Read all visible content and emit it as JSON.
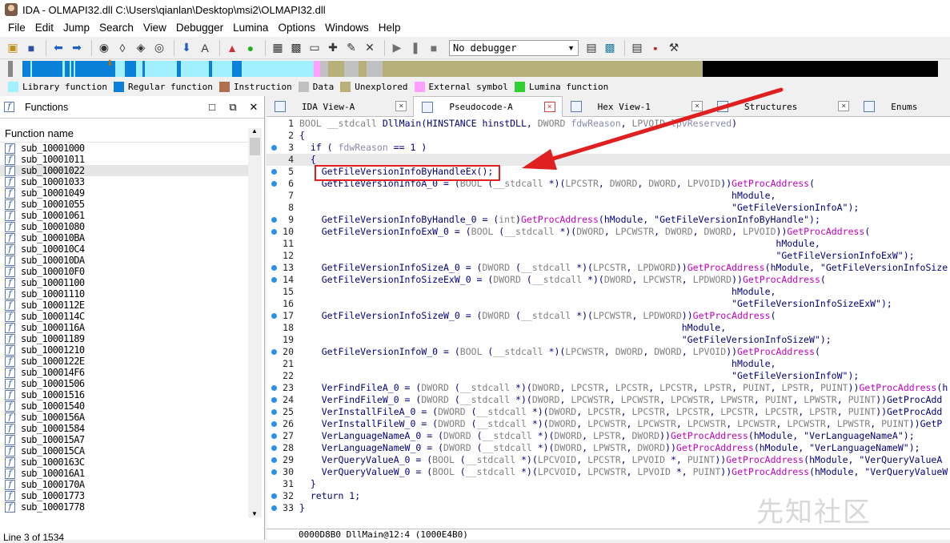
{
  "window": {
    "title": "IDA - OLMAPI32.dll C:\\Users\\qianlan\\Desktop\\msi2\\OLMAPI32.dll"
  },
  "menu": [
    "File",
    "Edit",
    "Jump",
    "Search",
    "View",
    "Debugger",
    "Lumina",
    "Options",
    "Windows",
    "Help"
  ],
  "toolbar": {
    "debugger_value": "No debugger"
  },
  "legend": [
    {
      "label": "Library function",
      "color": "#a0f0ff"
    },
    {
      "label": "Regular function",
      "color": "#0a80d8"
    },
    {
      "label": "Instruction",
      "color": "#b07050"
    },
    {
      "label": "Data",
      "color": "#c0c0c0"
    },
    {
      "label": "Unexplored",
      "color": "#b8b07a"
    },
    {
      "label": "External symbol",
      "color": "#ffa0ff"
    },
    {
      "label": "Lumina function",
      "color": "#30d030"
    }
  ],
  "functions_panel": {
    "title": "Functions",
    "column_header": "Function name",
    "status": "Line 3 of 1534",
    "selected_index": 3,
    "items": [
      "sub_10001000",
      "sub_10001011",
      "sub_10001022",
      "sub_10001033",
      "sub_10001049",
      "sub_10001055",
      "sub_10001061",
      "sub_10001080",
      "sub_100010BA",
      "sub_100010C4",
      "sub_100010DA",
      "sub_100010F0",
      "sub_10001100",
      "sub_10001110",
      "sub_1000112E",
      "sub_1000114C",
      "sub_1000116A",
      "sub_10001189",
      "sub_10001210",
      "sub_1000122E",
      "sub_100014F6",
      "sub_10001506",
      "sub_10001516",
      "sub_10001540",
      "sub_1000156A",
      "sub_10001584",
      "sub_100015A7",
      "sub_100015CA",
      "sub_1000163C",
      "sub_100016A1",
      "sub_1000170A",
      "sub_10001773",
      "sub_10001778"
    ]
  },
  "tabs": [
    "IDA View-A",
    "Pseudocode-A",
    "Hex View-1",
    "Structures",
    "Enums"
  ],
  "active_tab": 1,
  "code_status": "0000D8B0  DllMain@12:4 (1000E4B0)",
  "highlighted_line": 4,
  "watermark": "先知社区",
  "code": [
    {
      "n": "1",
      "dot": false,
      "t": "BOOL __stdcall DllMain(HINSTANCE hinstDLL, DWORD fdwReason, LPVOID lpvReserved)"
    },
    {
      "n": "2",
      "dot": false,
      "t": "{"
    },
    {
      "n": "3",
      "dot": true,
      "t": "  if ( fdwReason == 1 )"
    },
    {
      "n": "4",
      "dot": false,
      "t": "  {"
    },
    {
      "n": "5",
      "dot": true,
      "t": "    GetFileVersionInfoByHandleEx();"
    },
    {
      "n": "6",
      "dot": true,
      "t": "    GetFileVersionInfoA_0 = (BOOL (__stdcall *)(LPCSTR, DWORD, DWORD, LPVOID))GetProcAddress("
    },
    {
      "n": "7",
      "dot": false,
      "t": "                                                                              hModule,"
    },
    {
      "n": "8",
      "dot": false,
      "t": "                                                                              \"GetFileVersionInfoA\");"
    },
    {
      "n": "9",
      "dot": true,
      "t": "    GetFileVersionInfoByHandle_0 = (int)GetProcAddress(hModule, \"GetFileVersionInfoByHandle\");"
    },
    {
      "n": "10",
      "dot": true,
      "t": "    GetFileVersionInfoExW_0 = (BOOL (__stdcall *)(DWORD, LPCWSTR, DWORD, DWORD, LPVOID))GetProcAddress("
    },
    {
      "n": "11",
      "dot": false,
      "t": "                                                                                      hModule,"
    },
    {
      "n": "12",
      "dot": false,
      "t": "                                                                                      \"GetFileVersionInfoExW\");"
    },
    {
      "n": "13",
      "dot": true,
      "t": "    GetFileVersionInfoSizeA_0 = (DWORD (__stdcall *)(LPCSTR, LPDWORD))GetProcAddress(hModule, \"GetFileVersionInfoSize"
    },
    {
      "n": "14",
      "dot": true,
      "t": "    GetFileVersionInfoSizeExW_0 = (DWORD (__stdcall *)(DWORD, LPCWSTR, LPDWORD))GetProcAddress("
    },
    {
      "n": "15",
      "dot": false,
      "t": "                                                                              hModule,"
    },
    {
      "n": "16",
      "dot": false,
      "t": "                                                                              \"GetFileVersionInfoSizeExW\");"
    },
    {
      "n": "17",
      "dot": true,
      "t": "    GetFileVersionInfoSizeW_0 = (DWORD (__stdcall *)(LPCWSTR, LPDWORD))GetProcAddress("
    },
    {
      "n": "18",
      "dot": false,
      "t": "                                                                     hModule,"
    },
    {
      "n": "19",
      "dot": false,
      "t": "                                                                     \"GetFileVersionInfoSizeW\");"
    },
    {
      "n": "20",
      "dot": true,
      "t": "    GetFileVersionInfoW_0 = (BOOL (__stdcall *)(LPCWSTR, DWORD, DWORD, LPVOID))GetProcAddress("
    },
    {
      "n": "21",
      "dot": false,
      "t": "                                                                              hModule,"
    },
    {
      "n": "22",
      "dot": false,
      "t": "                                                                              \"GetFileVersionInfoW\");"
    },
    {
      "n": "23",
      "dot": true,
      "t": "    VerFindFileA_0 = (DWORD (__stdcall *)(DWORD, LPCSTR, LPCSTR, LPCSTR, LPSTR, PUINT, LPSTR, PUINT))GetProcAddress(h"
    },
    {
      "n": "24",
      "dot": true,
      "t": "    VerFindFileW_0 = (DWORD (__stdcall *)(DWORD, LPCWSTR, LPCWSTR, LPCWSTR, LPWSTR, PUINT, LPWSTR, PUINT))GetProcAdd"
    },
    {
      "n": "25",
      "dot": true,
      "t": "    VerInstallFileA_0 = (DWORD (__stdcall *)(DWORD, LPCSTR, LPCSTR, LPCSTR, LPCSTR, LPCSTR, LPSTR, PUINT))GetProcAdd"
    },
    {
      "n": "26",
      "dot": true,
      "t": "    VerInstallFileW_0 = (DWORD (__stdcall *)(DWORD, LPCWSTR, LPCWSTR, LPCWSTR, LPCWSTR, LPCWSTR, LPWSTR, PUINT))GetP"
    },
    {
      "n": "27",
      "dot": true,
      "t": "    VerLanguageNameA_0 = (DWORD (__stdcall *)(DWORD, LPSTR, DWORD))GetProcAddress(hModule, \"VerLanguageNameA\");"
    },
    {
      "n": "28",
      "dot": true,
      "t": "    VerLanguageNameW_0 = (DWORD (__stdcall *)(DWORD, LPWSTR, DWORD))GetProcAddress(hModule, \"VerLanguageNameW\");"
    },
    {
      "n": "29",
      "dot": true,
      "t": "    VerQueryValueA_0 = (BOOL (__stdcall *)(LPCVOID, LPCSTR, LPVOID *, PUINT))GetProcAddress(hModule, \"VerQueryValueA"
    },
    {
      "n": "30",
      "dot": true,
      "t": "    VerQueryValueW_0 = (BOOL (__stdcall *)(LPCVOID, LPCWSTR, LPVOID *, PUINT))GetProcAddress(hModule, \"VerQueryValueW"
    },
    {
      "n": "31",
      "dot": false,
      "t": "  }"
    },
    {
      "n": "32",
      "dot": true,
      "t": "  return 1;"
    },
    {
      "n": "33",
      "dot": true,
      "t": "}"
    }
  ]
}
